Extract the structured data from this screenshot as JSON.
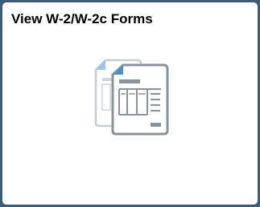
{
  "tile": {
    "title": "View W-2/W-2c Forms",
    "icon": "documents-icon"
  },
  "colors": {
    "background": "#3d5c7a",
    "tile": "#ffffff",
    "title_text": "#000000",
    "icon_outline": "#8a9399",
    "icon_back_outline": "#c7ccd0",
    "icon_accent": "#4a90c8"
  }
}
